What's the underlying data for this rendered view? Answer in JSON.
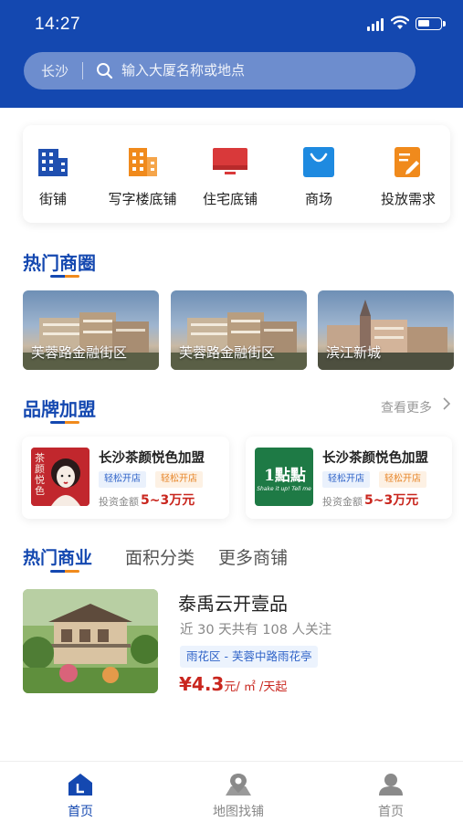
{
  "status_bar": {
    "time": "14:27"
  },
  "search": {
    "city": "长沙",
    "placeholder": "输入大厦名称或地点"
  },
  "categories": [
    {
      "label": "街铺",
      "icon": "building-icon",
      "color": "#1f4fb0"
    },
    {
      "label": "写字楼底铺",
      "icon": "office-building-icon",
      "color": "#f08a1c"
    },
    {
      "label": "住宅底铺",
      "icon": "monitor-icon",
      "color": "#d9393a"
    },
    {
      "label": "商场",
      "icon": "shopping-bag-icon",
      "color": "#1e8ae0"
    },
    {
      "label": "投放需求",
      "icon": "edit-note-icon",
      "color": "#f08a1c"
    }
  ],
  "hot_districts": {
    "title": "热门商圈",
    "items": [
      {
        "label": "芙蓉路金融街区"
      },
      {
        "label": "芙蓉路金融街区"
      },
      {
        "label": "滨江新城"
      }
    ]
  },
  "brands": {
    "title": "品牌加盟",
    "more_label": "查看更多",
    "items": [
      {
        "name": "长沙茶颜悦色加盟",
        "tags": [
          "轻松开店",
          "轻松开店"
        ],
        "invest_label": "投资金额",
        "invest_value": "5~3万元",
        "logo_text": "茶颜悦色"
      },
      {
        "name": "长沙茶颜悦色加盟",
        "tags": [
          "轻松开店",
          "轻松开店"
        ],
        "invest_label": "投资金额",
        "invest_value": "5~3万元",
        "logo_text": "1點點",
        "logo_subtext": "Shake it up! Tell me"
      }
    ]
  },
  "tabs": [
    {
      "label": "热门商业",
      "active": true
    },
    {
      "label": "面积分类",
      "active": false
    },
    {
      "label": "更多商铺",
      "active": false
    }
  ],
  "listing": {
    "title": "泰禹云开壹品",
    "follow_text": "近 30 天共有 108 人关注",
    "location": "雨花区 - 芙蓉中路雨花亭",
    "price_value": "¥4.3",
    "price_unit": "元/ ㎡ /天起"
  },
  "bottom_nav": [
    {
      "label": "首页",
      "icon": "home-icon",
      "active": true
    },
    {
      "label": "地图找铺",
      "icon": "map-pin-icon",
      "active": false
    },
    {
      "label": "首页",
      "icon": "user-icon",
      "active": false
    }
  ],
  "colors": {
    "primary": "#1448b0",
    "accent": "#f08a1c",
    "price": "#c9261e"
  }
}
